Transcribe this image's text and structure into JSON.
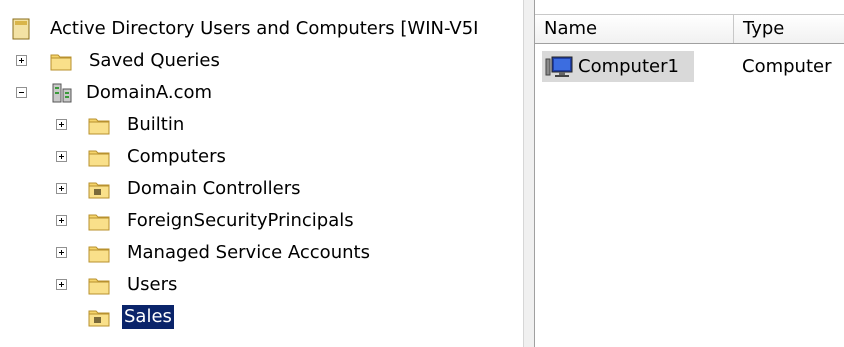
{
  "tree": {
    "root": {
      "label": "Active Directory Users and Computers [WIN-V5I",
      "icon": "aduc-console-icon"
    },
    "saved_queries": {
      "label": "Saved Queries",
      "icon": "folder-icon"
    },
    "domain": {
      "label": "DomainA.com",
      "icon": "domain-icon"
    },
    "children": [
      {
        "label": "Builtin",
        "icon": "folder-icon"
      },
      {
        "label": "Computers",
        "icon": "folder-icon"
      },
      {
        "label": "Domain Controllers",
        "icon": "ou-folder-icon"
      },
      {
        "label": "ForeignSecurityPrincipals",
        "icon": "folder-icon"
      },
      {
        "label": "Managed Service Accounts",
        "icon": "folder-icon"
      },
      {
        "label": "Users",
        "icon": "folder-icon"
      },
      {
        "label": "Sales",
        "icon": "ou-folder-icon",
        "selected": true
      }
    ]
  },
  "list": {
    "columns": [
      "Name",
      "Type"
    ],
    "rows": [
      {
        "name": "Computer1",
        "type": "Computer",
        "icon": "computer-icon"
      }
    ]
  },
  "colors": {
    "selection": "#0a246a",
    "row_highlight": "#d9d9d9",
    "folder": "#f5d46b"
  }
}
